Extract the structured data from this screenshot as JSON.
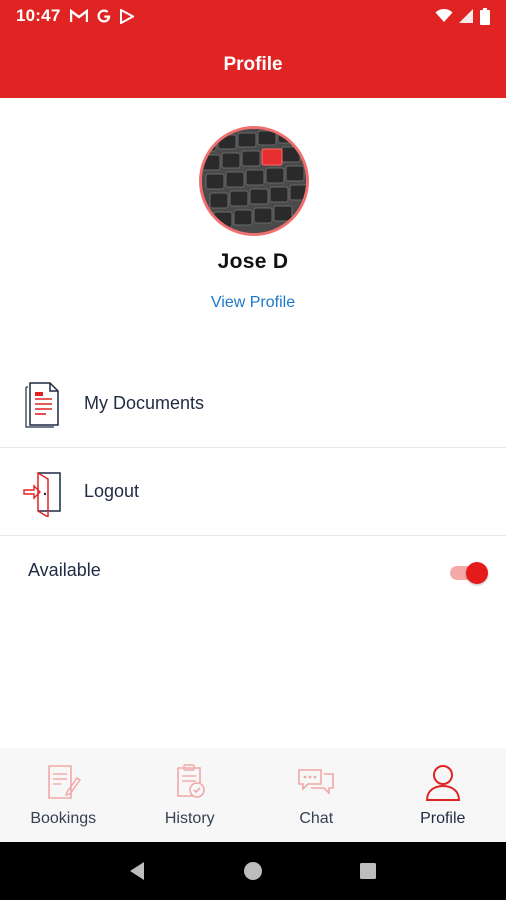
{
  "status_bar": {
    "time": "10:47",
    "app_icons": [
      "gmail-icon",
      "google-icon",
      "play-store-icon"
    ],
    "right_icons": [
      "wifi-icon",
      "signal-icon",
      "battery-icon"
    ]
  },
  "app_bar": {
    "title": "Profile"
  },
  "profile": {
    "name": "Jose D",
    "view_profile_label": "View Profile",
    "avatar_icon": "avatar-photo-keyboard"
  },
  "menu": [
    {
      "label": "My Documents",
      "icon": "document-icon"
    },
    {
      "label": "Logout",
      "icon": "logout-door-icon"
    }
  ],
  "availability": {
    "label": "Available",
    "enabled": true
  },
  "bottom_nav": {
    "items": [
      {
        "label": "Bookings",
        "icon": "bookings-icon",
        "active": false
      },
      {
        "label": "History",
        "icon": "history-icon",
        "active": false
      },
      {
        "label": "Chat",
        "icon": "chat-icon",
        "active": false
      },
      {
        "label": "Profile",
        "icon": "profile-icon",
        "active": true
      }
    ]
  },
  "colors": {
    "primary": "#e02424",
    "link": "#1e78c8",
    "icon_faded": "#f3a7a7",
    "icon_active": "#e02424",
    "text": "#1f2a44"
  }
}
